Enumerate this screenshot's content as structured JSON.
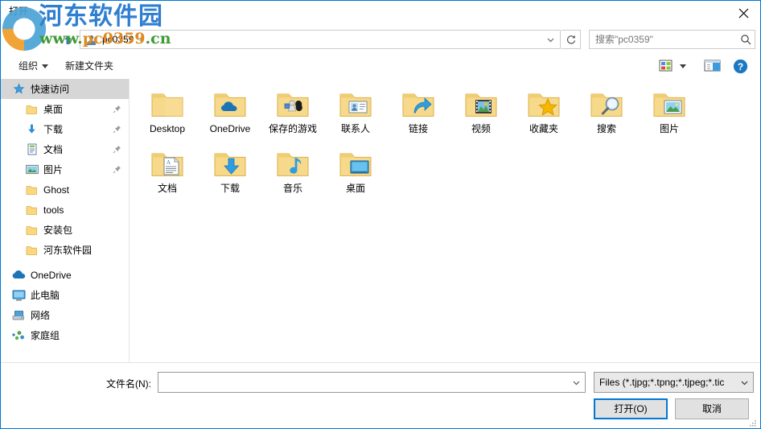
{
  "window": {
    "title": "打开",
    "close_icon": "close-icon"
  },
  "navbar": {
    "up_icon": "arrow-up-icon",
    "breadcrumb": {
      "user_icon": "user-account-icon",
      "path": "pc0359",
      "separator": "›"
    },
    "address_chevron_icon": "chevron-down-icon",
    "refresh_icon": "refresh-icon",
    "search": {
      "placeholder": "搜索\"pc0359\"",
      "icon": "search-icon"
    }
  },
  "toolbar": {
    "organize_label": "组织",
    "organize_caret_icon": "caret-down-icon",
    "new_folder_label": "新建文件夹",
    "view_icon": "view-options-icon",
    "view_caret_icon": "caret-down-icon",
    "preview_pane_icon": "preview-pane-icon",
    "help_icon": "help-icon"
  },
  "sidebar": {
    "items": [
      {
        "label": "快速访问",
        "icon": "quick-access-star-icon",
        "selected": true,
        "indent": false,
        "pinned": false
      },
      {
        "label": "桌面",
        "icon": "folder-icon",
        "selected": false,
        "indent": true,
        "pinned": true
      },
      {
        "label": "下载",
        "icon": "download-arrow-icon",
        "selected": false,
        "indent": true,
        "pinned": true
      },
      {
        "label": "文档",
        "icon": "documents-icon",
        "selected": false,
        "indent": true,
        "pinned": true
      },
      {
        "label": "图片",
        "icon": "pictures-icon",
        "selected": false,
        "indent": true,
        "pinned": true
      },
      {
        "label": "Ghost",
        "icon": "folder-icon",
        "selected": false,
        "indent": true,
        "pinned": false
      },
      {
        "label": "tools",
        "icon": "folder-icon",
        "selected": false,
        "indent": true,
        "pinned": false
      },
      {
        "label": "安装包",
        "icon": "folder-icon",
        "selected": false,
        "indent": true,
        "pinned": false
      },
      {
        "label": "河东软件园",
        "icon": "folder-icon",
        "selected": false,
        "indent": true,
        "pinned": false
      },
      {
        "label": "OneDrive",
        "icon": "onedrive-cloud-icon",
        "selected": false,
        "indent": false,
        "pinned": false
      },
      {
        "label": "此电脑",
        "icon": "this-pc-icon",
        "selected": false,
        "indent": false,
        "pinned": false
      },
      {
        "label": "网络",
        "icon": "network-icon",
        "selected": false,
        "indent": false,
        "pinned": false
      },
      {
        "label": "家庭组",
        "icon": "homegroup-icon",
        "selected": false,
        "indent": false,
        "pinned": false
      }
    ]
  },
  "files": [
    {
      "label": "Desktop",
      "icon": "folder-plain-icon"
    },
    {
      "label": "OneDrive",
      "icon": "folder-onedrive-icon"
    },
    {
      "label": "保存的游戏",
      "icon": "folder-saved-games-icon"
    },
    {
      "label": "联系人",
      "icon": "folder-contacts-icon"
    },
    {
      "label": "链接",
      "icon": "folder-links-icon"
    },
    {
      "label": "视频",
      "icon": "folder-videos-icon"
    },
    {
      "label": "收藏夹",
      "icon": "folder-favorites-icon"
    },
    {
      "label": "搜索",
      "icon": "folder-searches-icon"
    },
    {
      "label": "图片",
      "icon": "folder-pictures-icon"
    },
    {
      "label": "文档",
      "icon": "folder-documents-icon"
    },
    {
      "label": "下载",
      "icon": "folder-downloads-icon"
    },
    {
      "label": "音乐",
      "icon": "folder-music-icon"
    },
    {
      "label": "桌面",
      "icon": "folder-desktop-icon"
    }
  ],
  "bottom": {
    "filename_label": "文件名(N):",
    "filename_value": "",
    "filename_chevron_icon": "chevron-down-icon",
    "filetype_value": "Files (*.tjpg;*.tpng;*.tjpeg;*.tic",
    "filetype_chevron_icon": "chevron-down-icon",
    "open_label": "打开(O)",
    "cancel_label": "取消"
  },
  "watermark": {
    "site_name": "河东软件园",
    "url_green_1": "www.",
    "url_orange": "pc0359",
    "url_green_2": ".cn"
  }
}
